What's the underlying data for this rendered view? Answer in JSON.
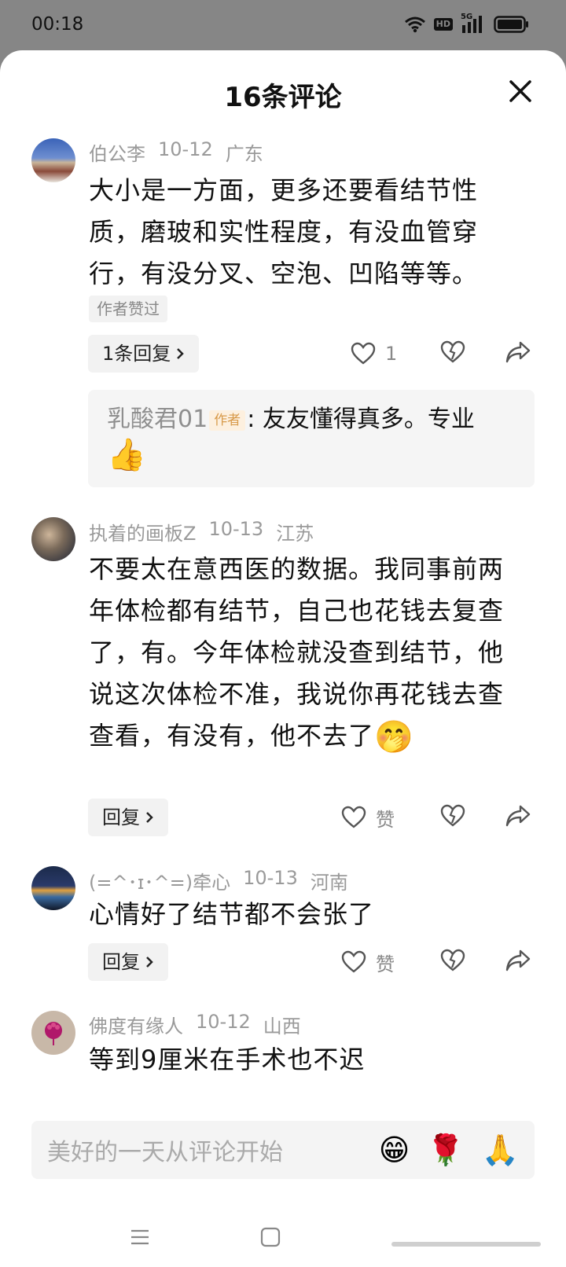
{
  "status": {
    "time": "00:18",
    "network": "5G",
    "hd_label": "HD",
    "wifi_icon": "wifi-icon",
    "battery_icon": "battery-icon"
  },
  "sheet": {
    "title": "16条评论",
    "close_icon": "close-icon"
  },
  "comments": [
    {
      "author": "伯公李",
      "date": "10-12",
      "location": "广东",
      "text": "大小是一方面，更多还要看结节性质，磨玻和实性程度，有没血管穿行，有没分叉、空泡、凹陷等等。",
      "badge": "作者赞过",
      "reply_button": "1条回复",
      "like_count": "1",
      "sub_reply": {
        "author": "乳酸君01",
        "tag": "作者",
        "separator": ":",
        "text": "友友懂得真多。专业",
        "emoji": "👍"
      }
    },
    {
      "author": "执着的画板Z",
      "date": "10-13",
      "location": "江苏",
      "text": "不要太在意西医的数据。我同事前两年体检都有结节，自己也花钱去复查了，有。今年体检就没查到结节，他说这次体检不准，我说你再花钱去查查看，有没有，他不去了",
      "emoji": "🤭",
      "reply_button": "回复",
      "like_label": "赞"
    },
    {
      "author": "(=^･ɪ･^=)牵心",
      "date": "10-13",
      "location": "河南",
      "text": "心情好了结节都不会张了",
      "reply_button": "回复",
      "like_label": "赞"
    },
    {
      "author": "佛度有缘人",
      "date": "10-12",
      "location": "山西",
      "text": "等到9厘米在手术也不迟"
    }
  ],
  "input": {
    "placeholder": "美好的一天从评论开始",
    "emojis": [
      "😁",
      "🌹",
      "🙏"
    ]
  },
  "nav": {
    "menu_icon": "menu-icon",
    "home_icon": "home-icon",
    "back_icon": "gesture-bar-icon"
  },
  "colors": {
    "background_dim": "#868686",
    "sheet": "#ffffff",
    "meta_text": "#9a9a9a",
    "author_tag_bg": "#fdf0df",
    "author_tag_fg": "#d89a4a"
  }
}
